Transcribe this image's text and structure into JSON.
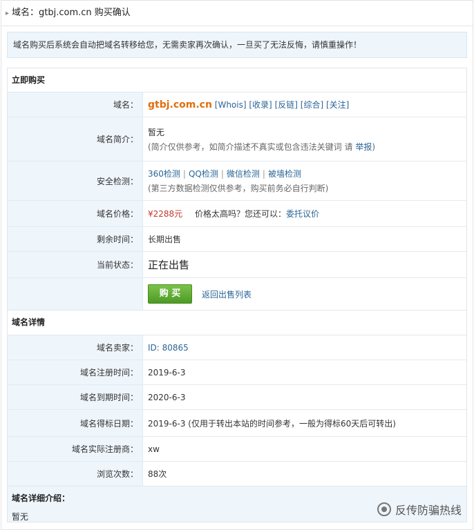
{
  "title": "域名：gtbj.com.cn 购买确认",
  "notice": "域名购买后系统会自动把域名转移给您，无需卖家再次确认，一旦买了无法反悔，请慎重操作！",
  "buy_section": {
    "heading": "立即购买",
    "rows": {
      "domain": {
        "label": "域名：",
        "value": "gtbj.com.cn",
        "links": [
          "[Whois]",
          "[收录]",
          "[反链]",
          "[综合]",
          "[关注]"
        ]
      },
      "intro": {
        "label": "域名简介：",
        "value": "暂无",
        "note": "(简介仅供参考，如简介描述不真实或包含违法关键词 请",
        "report": "举报",
        "note_end": ")"
      },
      "security": {
        "label": "安全检测：",
        "checks": [
          "360检测",
          "QQ检测",
          "微信检测",
          "被墙检测"
        ],
        "separator": "|",
        "note": "(第三方数据检测仅供参考，购买前务必自行判断)"
      },
      "price": {
        "label": "域名价格：",
        "value": "¥2288元",
        "ask": "价格太高吗？您还可以：",
        "link": "委托议价"
      },
      "remaining": {
        "label": "剩余时间：",
        "value": "长期出售"
      },
      "status": {
        "label": "当前状态：",
        "value": "正在出售"
      },
      "actions": {
        "buy": "购 买",
        "back": "返回出售列表"
      }
    }
  },
  "detail_section": {
    "heading": "域名详情",
    "rows": [
      {
        "label": "域名卖家：",
        "value": "ID: 80865",
        "link": true
      },
      {
        "label": "域名注册时间：",
        "value": "2019-6-3"
      },
      {
        "label": "域名到期时间：",
        "value": "2020-6-3"
      },
      {
        "label": "域名得标日期：",
        "value": "2019-6-3 (仅用于转出本站的时间参考，一般为得标60天后可转出)"
      },
      {
        "label": "域名实际注册商：",
        "value": "xw"
      },
      {
        "label": "浏览次数：",
        "value": "88次"
      }
    ]
  },
  "description": {
    "title": "域名详细介绍：",
    "value": "暂无"
  },
  "watermark": "反传防骗热线",
  "colors": {
    "accent_orange": "#e06e0b",
    "link": "#2a6496",
    "price": "#c0392b",
    "buy_green": "#5aa831",
    "label_bg": "#eef5fb"
  }
}
